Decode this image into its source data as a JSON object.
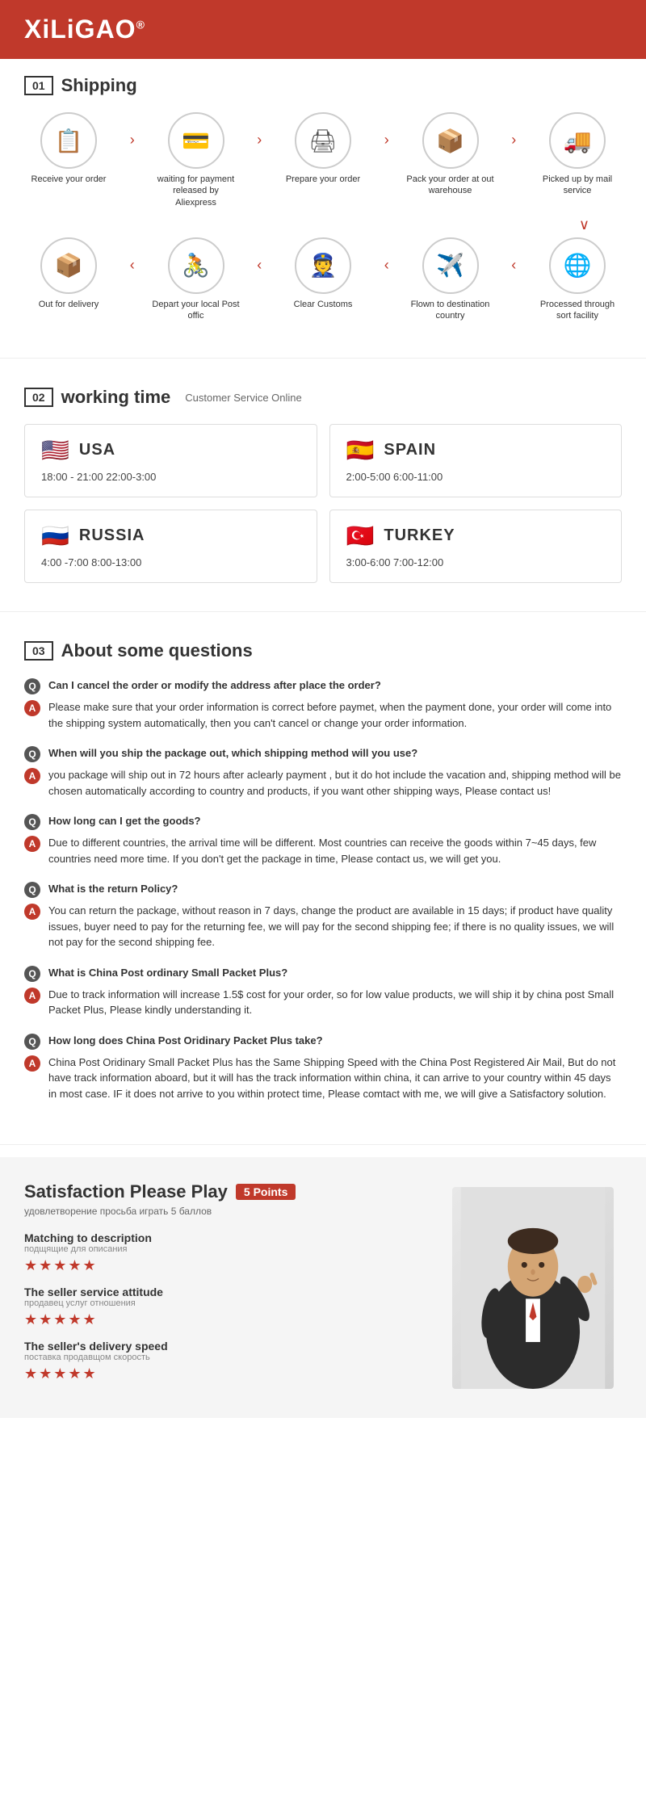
{
  "header": {
    "brand": "XiLiGAO",
    "trademark": "®"
  },
  "shipping": {
    "section_num": "01",
    "section_label": "Shipping",
    "row1": [
      {
        "icon": "📋",
        "label": "Receive your order"
      },
      {
        "arrow": "›"
      },
      {
        "icon": "💳",
        "label": "waiting for payment released by Aliexpress"
      },
      {
        "arrow": "›"
      },
      {
        "icon": "🖨",
        "label": "Prepare your order"
      },
      {
        "arrow": "›"
      },
      {
        "icon": "📦",
        "label": "Pack your order at out warehouse"
      },
      {
        "arrow": "›"
      },
      {
        "icon": "🚚",
        "label": "Picked up by mail service"
      }
    ],
    "row2": [
      {
        "icon": "📦",
        "label": "Out for delivery"
      },
      {
        "arrow": "‹"
      },
      {
        "icon": "🚴",
        "label": "Depart your local Post offic"
      },
      {
        "arrow": "‹"
      },
      {
        "icon": "👮",
        "label": "Clear Customs"
      },
      {
        "arrow": "‹"
      },
      {
        "icon": "✈️",
        "label": "Flown to destination country"
      },
      {
        "arrow": "‹"
      },
      {
        "icon": "🌐",
        "label": "Processed through sort facility"
      }
    ]
  },
  "working_time": {
    "section_num": "02",
    "section_label": "working time",
    "section_sub": "Customer Service Online",
    "countries": [
      {
        "flag": "🇺🇸",
        "name": "USA",
        "times": "18:00 - 21:00   22:00-3:00"
      },
      {
        "flag": "🇪🇸",
        "name": "SPAIN",
        "times": "2:00-5:00   6:00-11:00"
      },
      {
        "flag": "🇷🇺",
        "name": "RUSSIA",
        "times": "4:00 -7:00   8:00-13:00"
      },
      {
        "flag": "🇹🇷",
        "name": "TURKEY",
        "times": "3:00-6:00   7:00-12:00"
      }
    ]
  },
  "faq": {
    "section_num": "03",
    "section_label": "About some questions",
    "items": [
      {
        "question": "Can I cancel the order or modify the address after place the order?",
        "answer": "Please make sure that your order information is correct before paymet, when the payment done, your order will come into the shipping system automatically, then you can't cancel or change your order information."
      },
      {
        "question": "When will you ship the package out, which shipping method will you use?",
        "answer": "you package will ship out in 72 hours after aclearly payment , but it do hot include the vacation and, shipping method will be chosen automatically according to country and products, if you want other shipping ways, Please contact us!"
      },
      {
        "question": "How long can I get the goods?",
        "answer": "Due to different countries, the arrival time will be different. Most countries can receive the goods within 7~45 days, few countries need more time. If you don't get the package in time, Please contact us, we will get you."
      },
      {
        "question": "What is the return Policy?",
        "answer": "You can return the package, without reason in 7 days, change the product are available in 15 days; if product have quality issues, buyer need to pay for the returning fee, we will pay for the second shipping fee; if there is no quality issues, we will not pay for the second shipping fee."
      },
      {
        "question": "What is China Post ordinary Small Packet Plus?",
        "answer": "Due to track information will increase 1.5$ cost for your order, so for low value products, we will ship it by china post Small Packet Plus, Please kindly understanding it."
      },
      {
        "question": "How long does China Post Oridinary Packet Plus take?",
        "answer": "China Post Oridinary Small Packet Plus has the Same Shipping Speed with the China Post Registered Air Mail, But do not have track information aboard, but it will has the track information within china, it can arrive to your country within 45 days in most case. IF it does not arrive to you within protect time, Please comtact with me, we will give a Satisfactory solution."
      }
    ]
  },
  "satisfaction": {
    "title": "Satisfaction Please Play",
    "points_badge": "5 Points",
    "subtitle": "удовлетворение просьба играть 5 баллов",
    "ratings": [
      {
        "label": "Matching to description",
        "sublabel": "подщящие для описания",
        "stars": "★★★★★"
      },
      {
        "label": "The seller service attitude",
        "sublabel": "продавец услуг отношения",
        "stars": "★★★★★"
      },
      {
        "label": "The seller's delivery speed",
        "sublabel": "поставка продавщом скорость",
        "stars": "★★★★★"
      }
    ]
  }
}
